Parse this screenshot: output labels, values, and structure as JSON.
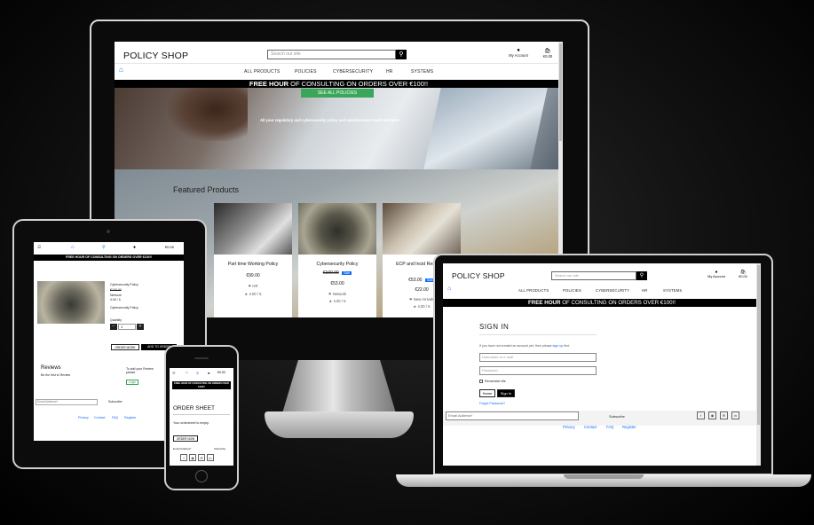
{
  "desktop": {
    "logo_bold": "POLICY",
    "logo_rest": "SHOP",
    "search_placeholder": "Search our site",
    "search_icon": "search-icon",
    "account_label": "My Account",
    "cart_total": "€0.00",
    "nav": [
      "ALL PRODUCTS",
      "POLICIES",
      "CYBERSECURITY",
      "HR",
      "SYSTEMS"
    ],
    "banner_bold": "FREE HOUR",
    "banner_rest": "OF CONSULTING ON ORDERS OVER €100!!",
    "hero_button": "SEE ALL POLICIES",
    "hero_text": "All your regulatory and cybersecurity policy and questionnaire needs are here!",
    "featured_title": "Featured Products",
    "products": [
      {
        "name": "Part time Working Policy",
        "price": "€99.00",
        "category": "HR",
        "rating": "4.00 / 5"
      },
      {
        "name": "Cybersecurity Policy",
        "old_price": "€100.00",
        "sale": "Sale",
        "price": "€53.00",
        "category": "Network",
        "rating": "4.00 / 5"
      },
      {
        "name": "ECP and Incid Response",
        "price": "€53.00",
        "sale": "Sale",
        "price2": "€22.00",
        "category": "New Arrivals",
        "rating": "4.00 / 5"
      }
    ]
  },
  "tablet": {
    "cart_total": "€0.00",
    "banner": "FREE HOUR OF CONSULTING ON ORDERS OVER €100!!",
    "product_title": "Cybersecurity Policy",
    "old_price": "€100.00",
    "category": "Network",
    "rating": "4.00 / 5",
    "product_subtitle": "Cybersecurity Policy",
    "quantity_label": "Quantity",
    "quantity_value": "1",
    "order_more_button": "ORDER MORE",
    "add_button": "ADD TO ORDER",
    "reviews_title": "Reviews",
    "reviews_text": "Be the first to Review",
    "review_prompt": "To add your Review please",
    "login_button": "Login",
    "email_placeholder": "Email Address*",
    "subscribe": "Subscribe",
    "footer_links": [
      "Privacy",
      "Contact",
      "FAQ",
      "Register"
    ]
  },
  "phone": {
    "cart_total": "€0.00",
    "banner": "FREE HOUR OF CONSULTING ON ORDERS OVER €100!!",
    "title": "ORDER SHEET",
    "empty_text": "Your ordersheet is empty.",
    "order_button": "ORDER NOW",
    "email_placeholder": "Email Address*",
    "subscribe": "Subscribe"
  },
  "laptop": {
    "logo_bold": "POLICY",
    "logo_rest": "SHOP",
    "search_placeholder": "Search our site",
    "account_label": "My Account",
    "cart_total": "€0.00",
    "nav": [
      "ALL PRODUCTS",
      "POLICIES",
      "CYBERSECURITY",
      "HR",
      "SYSTEMS"
    ],
    "banner_bold": "FREE HOUR",
    "banner_rest": "OF CONSULTING ON ORDERS OVER €100!!",
    "signin_title": "SIGN IN",
    "signin_note_a": "If you have not created an account yet, then please",
    "signin_note_link": "sign up",
    "signin_note_b": "first.",
    "username_placeholder": "Username or e-mail",
    "password_placeholder": "Password",
    "remember_label": "Remember Me",
    "home_button": "Home",
    "signin_button": "Sign In",
    "forgot_link": "Forgot Password?",
    "email_placeholder": "Email Address*",
    "subscribe": "Subscribe",
    "footer_links": [
      "Privacy",
      "Contact",
      "FAQ",
      "Register"
    ]
  },
  "colors": {
    "accent_green": "#3aa659",
    "link_blue": "#0d6efd",
    "banner_bg": "#000000"
  }
}
